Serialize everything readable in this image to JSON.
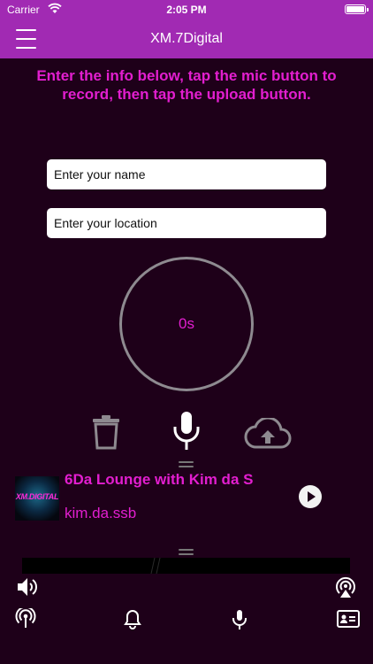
{
  "status_bar": {
    "carrier": "Carrier",
    "time": "2:05 PM"
  },
  "nav": {
    "title": "XM.7Digital"
  },
  "instructions": "Enter the info below, tap the mic button to record, then tap the upload button.",
  "form": {
    "name_placeholder": "Enter your name",
    "location_placeholder": "Enter your location"
  },
  "recorder": {
    "elapsed": "0s"
  },
  "player": {
    "title": "6Da Lounge with Kim da S",
    "host": "kim.da.ssb",
    "artwork_text": "XM.DIGITAL"
  },
  "colors": {
    "accent": "#a12ab3",
    "highlight": "#e21ecf",
    "background": "#1e0019"
  },
  "icons": {
    "controls": [
      "trash-icon",
      "mic-icon",
      "upload-icon"
    ],
    "player": [
      "play-icon"
    ],
    "bottom": [
      "volume-icon",
      "airplay-icon",
      "broadcast-icon",
      "bell-icon",
      "mic-icon",
      "contact-icon"
    ]
  }
}
